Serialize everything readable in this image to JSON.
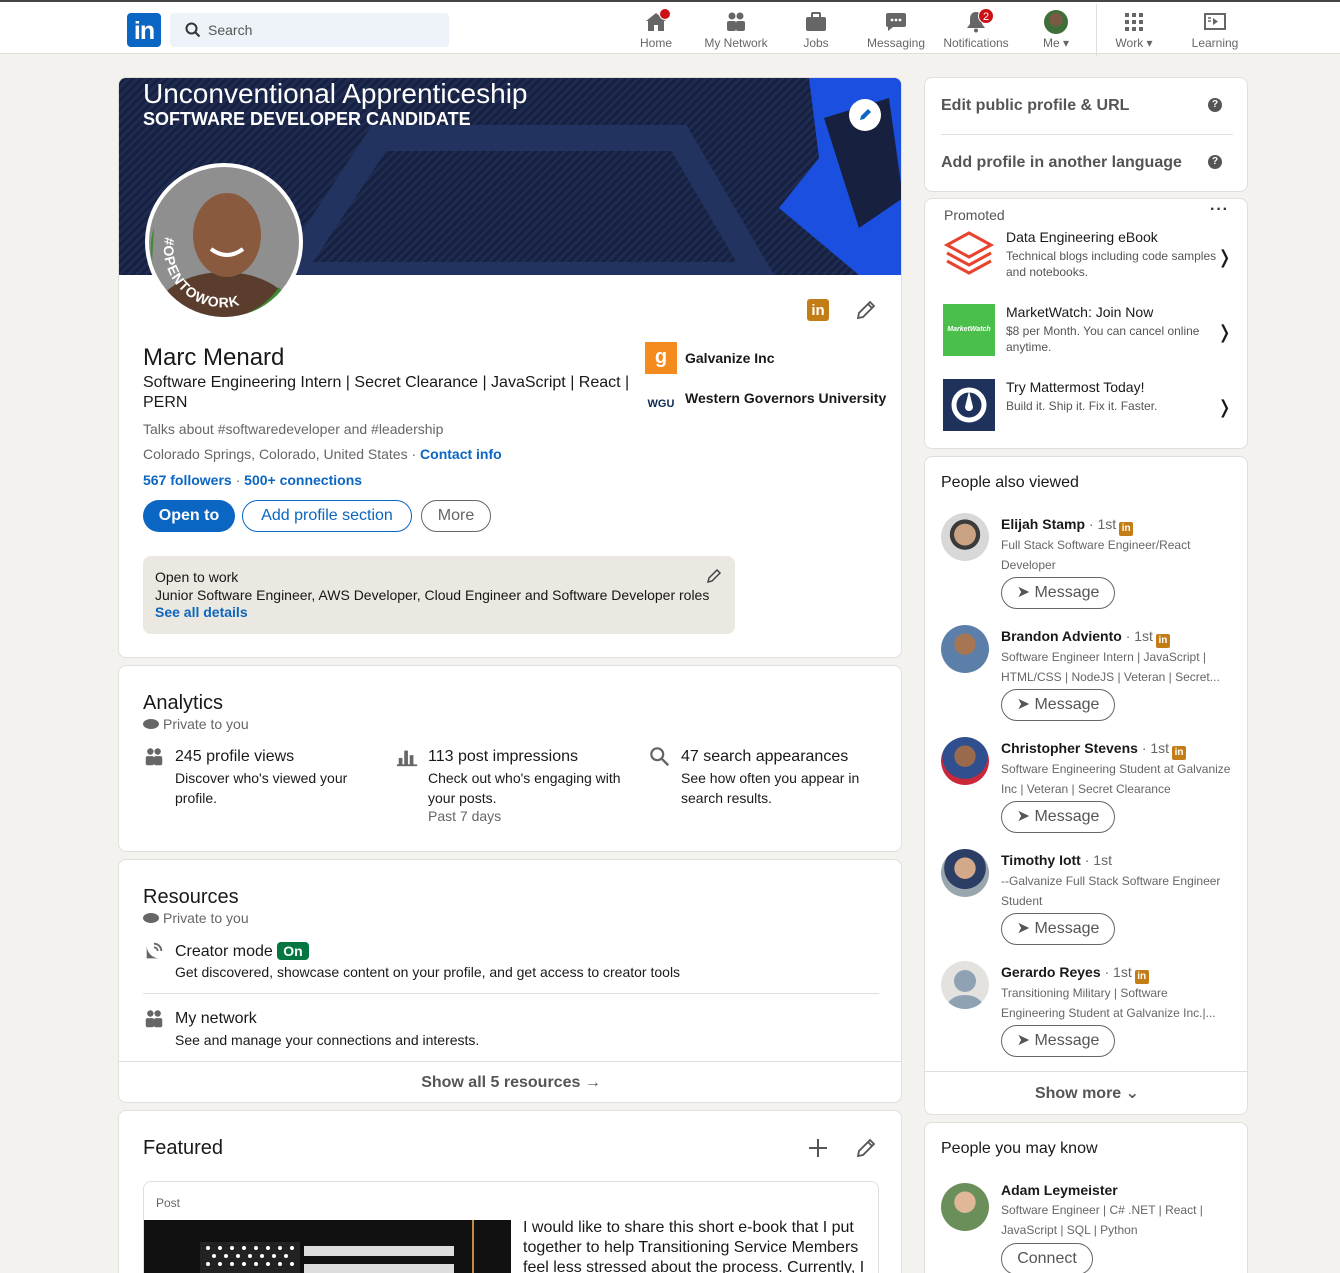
{
  "nav": {
    "logo": "in",
    "search_placeholder": "Search",
    "items": [
      {
        "label": "Home",
        "icon": "home-icon",
        "badge": ""
      },
      {
        "label": "My Network",
        "icon": "network-icon",
        "badge": ""
      },
      {
        "label": "Jobs",
        "icon": "briefcase-icon",
        "badge": ""
      },
      {
        "label": "Messaging",
        "icon": "messaging-icon",
        "badge": ""
      },
      {
        "label": "Notifications",
        "icon": "bell-icon",
        "badge": "2"
      },
      {
        "label": "Me",
        "icon": "avatar",
        "badge": ""
      },
      {
        "label": "Work",
        "icon": "grid-icon",
        "badge": ""
      },
      {
        "label": "Learning",
        "icon": "learning-icon",
        "badge": ""
      }
    ]
  },
  "profile": {
    "banner_title": "Unconventional Apprenticeship",
    "banner_subtitle": "SOFTWARE DEVELOPER CANDIDATE",
    "frame_text": "#OPENTOWORK",
    "name": "Marc Menard",
    "headline": "Software Engineering Intern | Secret Clearance | JavaScript | React | PERN",
    "talks_about": "Talks about #softwaredeveloper and #leadership",
    "location": "Colorado Springs, Colorado, United States",
    "location_sep": " · ",
    "contact_info": "Contact info",
    "followers": "567 followers",
    "connections_sep": " · ",
    "connections": "500+ connections",
    "btn_open_to": "Open to",
    "btn_add_section": "Add profile section",
    "btn_more": "More",
    "companies": [
      {
        "name": "Galvanize Inc",
        "logo_text": "g"
      },
      {
        "name": "Western Governors University",
        "logo_text": "WGU"
      }
    ],
    "open_to_work": {
      "title": "Open to work",
      "roles": "Junior Software Engineer, AWS Developer, Cloud Engineer and Software Developer roles",
      "link": "See all details"
    },
    "colors": {
      "accent": "#0a66c2",
      "frame": "#3a7d2e",
      "banner": "#1d2a4d"
    }
  },
  "analytics": {
    "title": "Analytics",
    "private": "Private to you",
    "items": [
      {
        "title": "245 profile views",
        "desc": "Discover who's viewed your profile.",
        "extra": ""
      },
      {
        "title": "113 post impressions",
        "desc": "Check out who's engaging with your posts.",
        "extra": "Past 7 days"
      },
      {
        "title": "47 search appearances",
        "desc": "See how often you appear in search results.",
        "extra": ""
      }
    ]
  },
  "resources": {
    "title": "Resources",
    "private": "Private to you",
    "creator_title": "Creator mode",
    "creator_badge": "On",
    "creator_desc": "Get discovered, showcase content on your profile, and get access to creator tools",
    "network_title": "My network",
    "network_desc": "See and manage your connections and interests.",
    "show_all": "Show all 5 resources →"
  },
  "featured": {
    "title": "Featured",
    "post_label": "Post",
    "post_text": "I would like to share this short e-book that I put together to help Transitioning Service Members feel less stressed about the process. Currently, I"
  },
  "sidebar": {
    "edit_url": "Edit public profile & URL",
    "add_language": "Add profile in another language",
    "promoted_title": "Promoted",
    "promoted": [
      {
        "title": "Data Engineering eBook",
        "desc": "Technical blogs including code samples and notebooks.",
        "logo": "databricks"
      },
      {
        "title": "MarketWatch: Join Now",
        "desc": "$8 per Month. You can cancel online anytime.",
        "logo": "MarketWatch"
      },
      {
        "title": "Try Mattermost Today!",
        "desc": "Build it. Ship it. Fix it. Faster.",
        "logo": "mattermost"
      }
    ],
    "also_viewed_title": "People also viewed",
    "also_viewed": [
      {
        "name": "Elijah Stamp",
        "degree": "· 1st",
        "desc": "Full Stack Software Engineer/React Developer",
        "button": "Message"
      },
      {
        "name": "Brandon Adviento",
        "degree": "· 1st",
        "desc": "Software Engineer Intern | JavaScript | HTML/CSS | NodeJS | Veteran | Secret...",
        "button": "Message"
      },
      {
        "name": "Christopher Stevens",
        "degree": "· 1st",
        "desc": "Software Engineering Student at Galvanize Inc | Veteran | Secret Clearance",
        "button": "Message"
      },
      {
        "name": "Timothy Iott",
        "degree": "· 1st",
        "desc": "--Galvanize Full Stack Software Engineer Student",
        "button": "Message"
      },
      {
        "name": "Gerardo Reyes",
        "degree": "· 1st",
        "desc": "Transitioning Military | Software Engineering Student at Galvanize Inc.|...",
        "button": "Message"
      }
    ],
    "show_more": "Show more",
    "may_know_title": "People you may know",
    "may_know": [
      {
        "name": "Adam Leymeister",
        "desc": "Software Engineer | C# .NET | React | JavaScript | SQL | Python",
        "button": "Connect"
      }
    ]
  }
}
